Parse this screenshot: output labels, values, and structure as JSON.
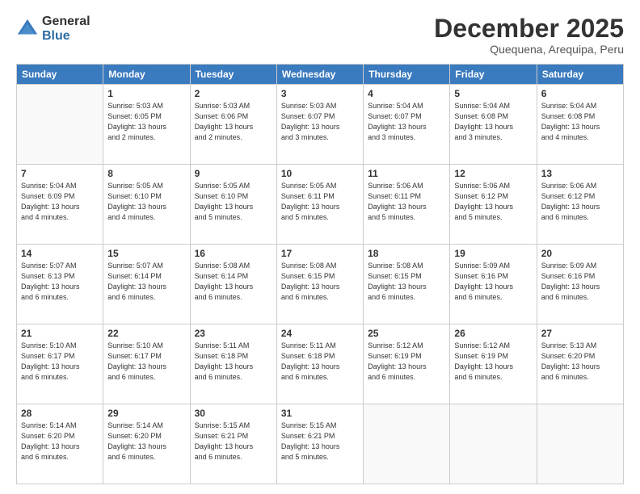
{
  "header": {
    "logo_general": "General",
    "logo_blue": "Blue",
    "month_title": "December 2025",
    "subtitle": "Quequena, Arequipa, Peru"
  },
  "weekdays": [
    "Sunday",
    "Monday",
    "Tuesday",
    "Wednesday",
    "Thursday",
    "Friday",
    "Saturday"
  ],
  "weeks": [
    [
      {
        "day": "",
        "info": ""
      },
      {
        "day": "1",
        "info": "Sunrise: 5:03 AM\nSunset: 6:05 PM\nDaylight: 13 hours\nand 2 minutes."
      },
      {
        "day": "2",
        "info": "Sunrise: 5:03 AM\nSunset: 6:06 PM\nDaylight: 13 hours\nand 2 minutes."
      },
      {
        "day": "3",
        "info": "Sunrise: 5:03 AM\nSunset: 6:07 PM\nDaylight: 13 hours\nand 3 minutes."
      },
      {
        "day": "4",
        "info": "Sunrise: 5:04 AM\nSunset: 6:07 PM\nDaylight: 13 hours\nand 3 minutes."
      },
      {
        "day": "5",
        "info": "Sunrise: 5:04 AM\nSunset: 6:08 PM\nDaylight: 13 hours\nand 3 minutes."
      },
      {
        "day": "6",
        "info": "Sunrise: 5:04 AM\nSunset: 6:08 PM\nDaylight: 13 hours\nand 4 minutes."
      }
    ],
    [
      {
        "day": "7",
        "info": "Sunrise: 5:04 AM\nSunset: 6:09 PM\nDaylight: 13 hours\nand 4 minutes."
      },
      {
        "day": "8",
        "info": "Sunrise: 5:05 AM\nSunset: 6:10 PM\nDaylight: 13 hours\nand 4 minutes."
      },
      {
        "day": "9",
        "info": "Sunrise: 5:05 AM\nSunset: 6:10 PM\nDaylight: 13 hours\nand 5 minutes."
      },
      {
        "day": "10",
        "info": "Sunrise: 5:05 AM\nSunset: 6:11 PM\nDaylight: 13 hours\nand 5 minutes."
      },
      {
        "day": "11",
        "info": "Sunrise: 5:06 AM\nSunset: 6:11 PM\nDaylight: 13 hours\nand 5 minutes."
      },
      {
        "day": "12",
        "info": "Sunrise: 5:06 AM\nSunset: 6:12 PM\nDaylight: 13 hours\nand 5 minutes."
      },
      {
        "day": "13",
        "info": "Sunrise: 5:06 AM\nSunset: 6:12 PM\nDaylight: 13 hours\nand 6 minutes."
      }
    ],
    [
      {
        "day": "14",
        "info": "Sunrise: 5:07 AM\nSunset: 6:13 PM\nDaylight: 13 hours\nand 6 minutes."
      },
      {
        "day": "15",
        "info": "Sunrise: 5:07 AM\nSunset: 6:14 PM\nDaylight: 13 hours\nand 6 minutes."
      },
      {
        "day": "16",
        "info": "Sunrise: 5:08 AM\nSunset: 6:14 PM\nDaylight: 13 hours\nand 6 minutes."
      },
      {
        "day": "17",
        "info": "Sunrise: 5:08 AM\nSunset: 6:15 PM\nDaylight: 13 hours\nand 6 minutes."
      },
      {
        "day": "18",
        "info": "Sunrise: 5:08 AM\nSunset: 6:15 PM\nDaylight: 13 hours\nand 6 minutes."
      },
      {
        "day": "19",
        "info": "Sunrise: 5:09 AM\nSunset: 6:16 PM\nDaylight: 13 hours\nand 6 minutes."
      },
      {
        "day": "20",
        "info": "Sunrise: 5:09 AM\nSunset: 6:16 PM\nDaylight: 13 hours\nand 6 minutes."
      }
    ],
    [
      {
        "day": "21",
        "info": "Sunrise: 5:10 AM\nSunset: 6:17 PM\nDaylight: 13 hours\nand 6 minutes."
      },
      {
        "day": "22",
        "info": "Sunrise: 5:10 AM\nSunset: 6:17 PM\nDaylight: 13 hours\nand 6 minutes."
      },
      {
        "day": "23",
        "info": "Sunrise: 5:11 AM\nSunset: 6:18 PM\nDaylight: 13 hours\nand 6 minutes."
      },
      {
        "day": "24",
        "info": "Sunrise: 5:11 AM\nSunset: 6:18 PM\nDaylight: 13 hours\nand 6 minutes."
      },
      {
        "day": "25",
        "info": "Sunrise: 5:12 AM\nSunset: 6:19 PM\nDaylight: 13 hours\nand 6 minutes."
      },
      {
        "day": "26",
        "info": "Sunrise: 5:12 AM\nSunset: 6:19 PM\nDaylight: 13 hours\nand 6 minutes."
      },
      {
        "day": "27",
        "info": "Sunrise: 5:13 AM\nSunset: 6:20 PM\nDaylight: 13 hours\nand 6 minutes."
      }
    ],
    [
      {
        "day": "28",
        "info": "Sunrise: 5:14 AM\nSunset: 6:20 PM\nDaylight: 13 hours\nand 6 minutes."
      },
      {
        "day": "29",
        "info": "Sunrise: 5:14 AM\nSunset: 6:20 PM\nDaylight: 13 hours\nand 6 minutes."
      },
      {
        "day": "30",
        "info": "Sunrise: 5:15 AM\nSunset: 6:21 PM\nDaylight: 13 hours\nand 6 minutes."
      },
      {
        "day": "31",
        "info": "Sunrise: 5:15 AM\nSunset: 6:21 PM\nDaylight: 13 hours\nand 5 minutes."
      },
      {
        "day": "",
        "info": ""
      },
      {
        "day": "",
        "info": ""
      },
      {
        "day": "",
        "info": ""
      }
    ]
  ]
}
